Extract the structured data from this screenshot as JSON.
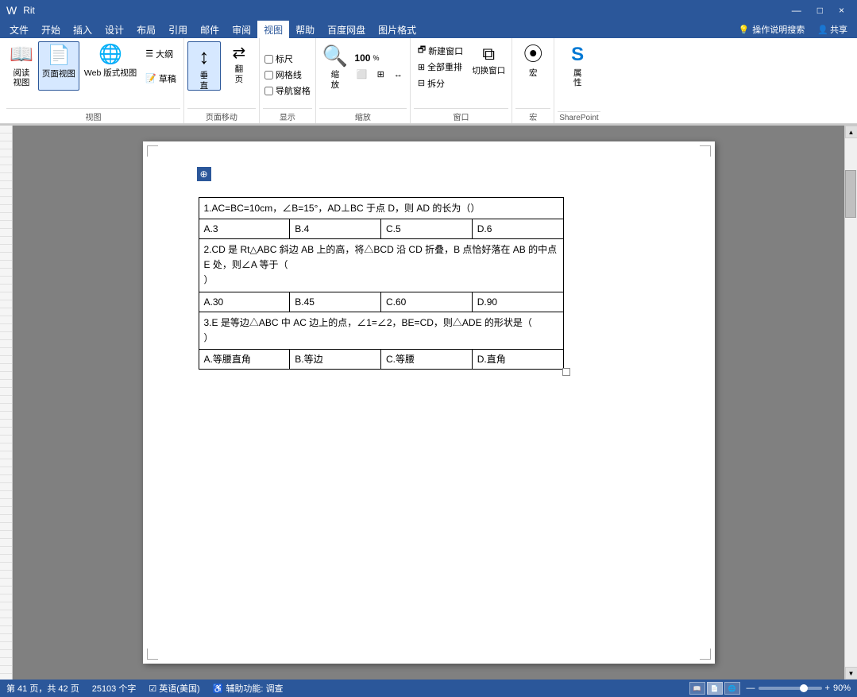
{
  "titlebar": {
    "title": "Rit",
    "app": "Word",
    "controls": [
      "—",
      "□",
      "×"
    ]
  },
  "menubar": {
    "items": [
      "文件",
      "开始",
      "插入",
      "设计",
      "布局",
      "引用",
      "邮件",
      "审阅",
      "视图",
      "帮助",
      "百度网盘",
      "图片格式"
    ],
    "active": "视图",
    "search_placeholder": "操作说明搜索",
    "share": "共享"
  },
  "ribbon": {
    "active_tab": "视图",
    "groups": [
      {
        "label": "视图",
        "buttons": [
          {
            "id": "read-view",
            "icon": "📖",
            "label": "阅读\n视图"
          },
          {
            "id": "page-view",
            "icon": "📄",
            "label": "页面视图",
            "active": true
          },
          {
            "id": "web-view",
            "icon": "🌐",
            "label": "Web 版式视图"
          }
        ],
        "small_btns": [
          {
            "id": "outline",
            "icon": "☰",
            "label": "大纲"
          },
          {
            "id": "draft",
            "icon": "📝",
            "label": "草稿"
          }
        ]
      },
      {
        "label": "页面移动",
        "buttons": [
          {
            "id": "vertical",
            "icon": "↕",
            "label": "垂\n直",
            "active": true
          },
          {
            "id": "flip-page",
            "icon": "⟺",
            "label": "翻\n页"
          }
        ]
      },
      {
        "label": "显示",
        "checkboxes": [
          {
            "id": "ruler",
            "label": "标尺",
            "checked": false
          },
          {
            "id": "grid",
            "label": "网格线",
            "checked": false
          },
          {
            "id": "nav",
            "label": "导航窗格",
            "checked": false
          }
        ]
      },
      {
        "label": "缩放",
        "buttons": [
          {
            "id": "zoom",
            "icon": "🔍",
            "label": "缩\n放"
          },
          {
            "id": "zoom-100",
            "icon": "100",
            "label": "100%"
          },
          {
            "id": "one-page",
            "icon": "⬜",
            "label": ""
          },
          {
            "id": "multi-page",
            "icon": "⬛",
            "label": ""
          },
          {
            "id": "page-width",
            "icon": "↔",
            "label": ""
          }
        ]
      },
      {
        "label": "窗口",
        "buttons": [
          {
            "id": "new-window",
            "icon": "🗗",
            "label": "新建窗口"
          },
          {
            "id": "arrange-all",
            "icon": "⊞",
            "label": "全部重排"
          },
          {
            "id": "split",
            "icon": "⊟",
            "label": "拆分"
          },
          {
            "id": "switch-window",
            "icon": "⧉",
            "label": "切换窗口"
          }
        ]
      },
      {
        "label": "宏",
        "buttons": [
          {
            "id": "macro",
            "icon": "⦿",
            "label": "宏"
          }
        ]
      },
      {
        "label": "SharePoint",
        "buttons": [
          {
            "id": "sharepoint",
            "icon": "S",
            "label": "属\n性"
          }
        ]
      }
    ]
  },
  "document": {
    "table": {
      "rows": [
        {
          "type": "question",
          "colspan": 4,
          "content": "1.AC=BC=10cm，∠B=15°，AD⊥BC 于点 D，则 AD 的长为（）"
        },
        {
          "type": "options",
          "cells": [
            "A.3",
            "B.4",
            "C.5",
            "D.6"
          ]
        },
        {
          "type": "question",
          "colspan": 4,
          "content": "2.CD 是 Rt△ABC 斜边 AB 上的高，将△BCD 沿 CD 折叠，B 点恰好落在 AB 的中点 E 处，则∠A 等于（\n）"
        },
        {
          "type": "options",
          "cells": [
            "A.30",
            "B.45",
            "C.60",
            "D.90"
          ]
        },
        {
          "type": "question",
          "colspan": 4,
          "content": "3.E 是等边△ABC 中 AC 边上的点，∠1=∠2，BE=CD，则△ADE 的形状是（\n）"
        },
        {
          "type": "options",
          "cells": [
            "A.等腰直角",
            "B.等边",
            "C.等腰",
            "D.直角"
          ]
        }
      ]
    }
  },
  "statusbar": {
    "page_info": "第 41 页，共 42 页",
    "word_count": "25103 个字",
    "language": "英语(美国)",
    "accessibility": "辅助功能: 调查",
    "zoom": "90%",
    "view_modes": [
      "阅读",
      "页面",
      "Web"
    ]
  }
}
